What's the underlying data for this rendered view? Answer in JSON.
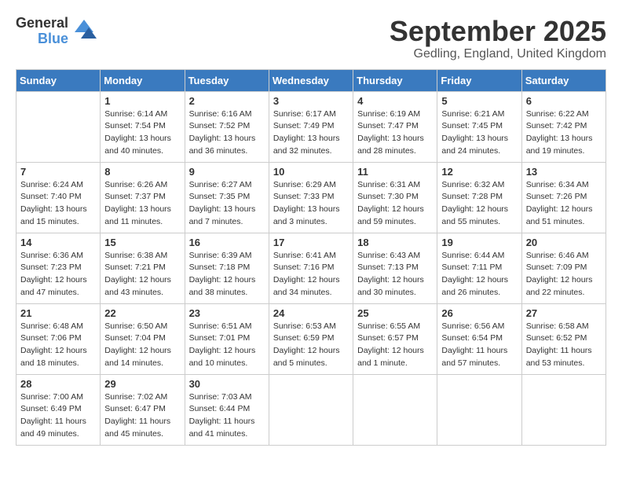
{
  "header": {
    "logo_general": "General",
    "logo_blue": "Blue",
    "month_title": "September 2025",
    "subtitle": "Gedling, England, United Kingdom"
  },
  "days_of_week": [
    "Sunday",
    "Monday",
    "Tuesday",
    "Wednesday",
    "Thursday",
    "Friday",
    "Saturday"
  ],
  "weeks": [
    [
      {
        "day": "",
        "sunrise": "",
        "sunset": "",
        "daylight": ""
      },
      {
        "day": "1",
        "sunrise": "Sunrise: 6:14 AM",
        "sunset": "Sunset: 7:54 PM",
        "daylight": "Daylight: 13 hours and 40 minutes."
      },
      {
        "day": "2",
        "sunrise": "Sunrise: 6:16 AM",
        "sunset": "Sunset: 7:52 PM",
        "daylight": "Daylight: 13 hours and 36 minutes."
      },
      {
        "day": "3",
        "sunrise": "Sunrise: 6:17 AM",
        "sunset": "Sunset: 7:49 PM",
        "daylight": "Daylight: 13 hours and 32 minutes."
      },
      {
        "day": "4",
        "sunrise": "Sunrise: 6:19 AM",
        "sunset": "Sunset: 7:47 PM",
        "daylight": "Daylight: 13 hours and 28 minutes."
      },
      {
        "day": "5",
        "sunrise": "Sunrise: 6:21 AM",
        "sunset": "Sunset: 7:45 PM",
        "daylight": "Daylight: 13 hours and 24 minutes."
      },
      {
        "day": "6",
        "sunrise": "Sunrise: 6:22 AM",
        "sunset": "Sunset: 7:42 PM",
        "daylight": "Daylight: 13 hours and 19 minutes."
      }
    ],
    [
      {
        "day": "7",
        "sunrise": "Sunrise: 6:24 AM",
        "sunset": "Sunset: 7:40 PM",
        "daylight": "Daylight: 13 hours and 15 minutes."
      },
      {
        "day": "8",
        "sunrise": "Sunrise: 6:26 AM",
        "sunset": "Sunset: 7:37 PM",
        "daylight": "Daylight: 13 hours and 11 minutes."
      },
      {
        "day": "9",
        "sunrise": "Sunrise: 6:27 AM",
        "sunset": "Sunset: 7:35 PM",
        "daylight": "Daylight: 13 hours and 7 minutes."
      },
      {
        "day": "10",
        "sunrise": "Sunrise: 6:29 AM",
        "sunset": "Sunset: 7:33 PM",
        "daylight": "Daylight: 13 hours and 3 minutes."
      },
      {
        "day": "11",
        "sunrise": "Sunrise: 6:31 AM",
        "sunset": "Sunset: 7:30 PM",
        "daylight": "Daylight: 12 hours and 59 minutes."
      },
      {
        "day": "12",
        "sunrise": "Sunrise: 6:32 AM",
        "sunset": "Sunset: 7:28 PM",
        "daylight": "Daylight: 12 hours and 55 minutes."
      },
      {
        "day": "13",
        "sunrise": "Sunrise: 6:34 AM",
        "sunset": "Sunset: 7:26 PM",
        "daylight": "Daylight: 12 hours and 51 minutes."
      }
    ],
    [
      {
        "day": "14",
        "sunrise": "Sunrise: 6:36 AM",
        "sunset": "Sunset: 7:23 PM",
        "daylight": "Daylight: 12 hours and 47 minutes."
      },
      {
        "day": "15",
        "sunrise": "Sunrise: 6:38 AM",
        "sunset": "Sunset: 7:21 PM",
        "daylight": "Daylight: 12 hours and 43 minutes."
      },
      {
        "day": "16",
        "sunrise": "Sunrise: 6:39 AM",
        "sunset": "Sunset: 7:18 PM",
        "daylight": "Daylight: 12 hours and 38 minutes."
      },
      {
        "day": "17",
        "sunrise": "Sunrise: 6:41 AM",
        "sunset": "Sunset: 7:16 PM",
        "daylight": "Daylight: 12 hours and 34 minutes."
      },
      {
        "day": "18",
        "sunrise": "Sunrise: 6:43 AM",
        "sunset": "Sunset: 7:13 PM",
        "daylight": "Daylight: 12 hours and 30 minutes."
      },
      {
        "day": "19",
        "sunrise": "Sunrise: 6:44 AM",
        "sunset": "Sunset: 7:11 PM",
        "daylight": "Daylight: 12 hours and 26 minutes."
      },
      {
        "day": "20",
        "sunrise": "Sunrise: 6:46 AM",
        "sunset": "Sunset: 7:09 PM",
        "daylight": "Daylight: 12 hours and 22 minutes."
      }
    ],
    [
      {
        "day": "21",
        "sunrise": "Sunrise: 6:48 AM",
        "sunset": "Sunset: 7:06 PM",
        "daylight": "Daylight: 12 hours and 18 minutes."
      },
      {
        "day": "22",
        "sunrise": "Sunrise: 6:50 AM",
        "sunset": "Sunset: 7:04 PM",
        "daylight": "Daylight: 12 hours and 14 minutes."
      },
      {
        "day": "23",
        "sunrise": "Sunrise: 6:51 AM",
        "sunset": "Sunset: 7:01 PM",
        "daylight": "Daylight: 12 hours and 10 minutes."
      },
      {
        "day": "24",
        "sunrise": "Sunrise: 6:53 AM",
        "sunset": "Sunset: 6:59 PM",
        "daylight": "Daylight: 12 hours and 5 minutes."
      },
      {
        "day": "25",
        "sunrise": "Sunrise: 6:55 AM",
        "sunset": "Sunset: 6:57 PM",
        "daylight": "Daylight: 12 hours and 1 minute."
      },
      {
        "day": "26",
        "sunrise": "Sunrise: 6:56 AM",
        "sunset": "Sunset: 6:54 PM",
        "daylight": "Daylight: 11 hours and 57 minutes."
      },
      {
        "day": "27",
        "sunrise": "Sunrise: 6:58 AM",
        "sunset": "Sunset: 6:52 PM",
        "daylight": "Daylight: 11 hours and 53 minutes."
      }
    ],
    [
      {
        "day": "28",
        "sunrise": "Sunrise: 7:00 AM",
        "sunset": "Sunset: 6:49 PM",
        "daylight": "Daylight: 11 hours and 49 minutes."
      },
      {
        "day": "29",
        "sunrise": "Sunrise: 7:02 AM",
        "sunset": "Sunset: 6:47 PM",
        "daylight": "Daylight: 11 hours and 45 minutes."
      },
      {
        "day": "30",
        "sunrise": "Sunrise: 7:03 AM",
        "sunset": "Sunset: 6:44 PM",
        "daylight": "Daylight: 11 hours and 41 minutes."
      },
      {
        "day": "",
        "sunrise": "",
        "sunset": "",
        "daylight": ""
      },
      {
        "day": "",
        "sunrise": "",
        "sunset": "",
        "daylight": ""
      },
      {
        "day": "",
        "sunrise": "",
        "sunset": "",
        "daylight": ""
      },
      {
        "day": "",
        "sunrise": "",
        "sunset": "",
        "daylight": ""
      }
    ]
  ]
}
